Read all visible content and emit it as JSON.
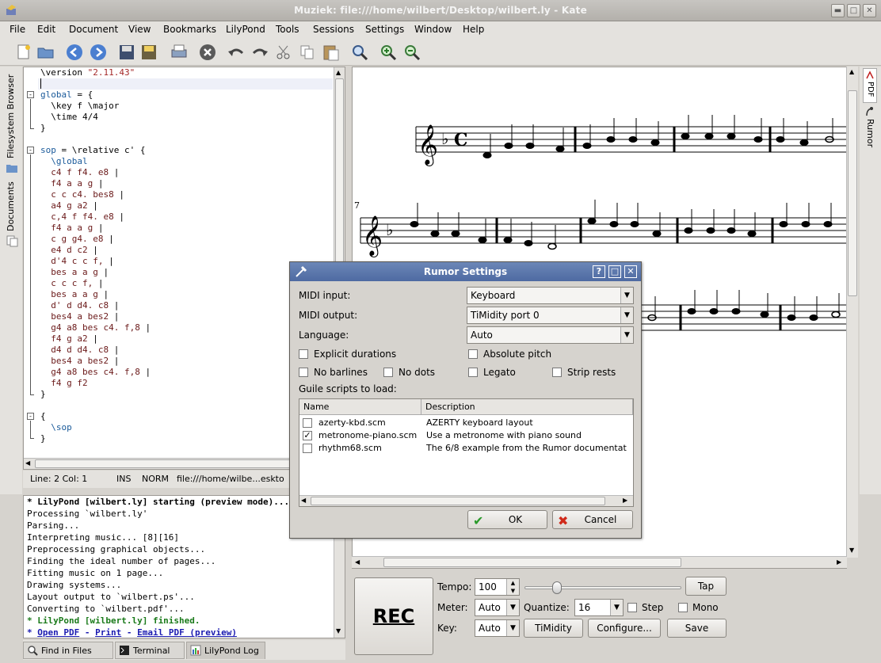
{
  "window": {
    "title": "Muziek: file:///home/wilbert/Desktop/wilbert.ly - Kate"
  },
  "menu": [
    "File",
    "Edit",
    "Document",
    "View",
    "Bookmarks",
    "LilyPond",
    "Tools",
    "Sessions",
    "Settings",
    "Window",
    "Help"
  ],
  "side_tabs": {
    "filesystem": "Filesystem Browser",
    "documents": "Documents"
  },
  "right_tabs": {
    "pdf": "PDF",
    "rumor": "Rumor"
  },
  "status": {
    "position": "Line: 2 Col: 1",
    "mode": "INS",
    "norm": "NORM",
    "path": "file:///home/wilbe...eskto"
  },
  "log": {
    "l1": "* LilyPond [wilbert.ly] starting (preview mode)...",
    "l2": "Processing `wilbert.ly'",
    "l3": "Parsing...",
    "l4": "Interpreting music... [8][16]",
    "l5": "Preprocessing graphical objects...",
    "l6": "Finding the ideal number of pages...",
    "l7": "Fitting music on 1 page...",
    "l8": "Drawing systems...",
    "l9": "Layout output to `wilbert.ps'...",
    "l10": "Converting to `wilbert.pdf'...",
    "l11": "* LilyPond [wilbert.ly] finished.",
    "link_prefix": "* ",
    "open_pdf": "Open PDF",
    "sep": " - ",
    "print": "Print",
    "email_pdf": "Email PDF (preview)"
  },
  "bottom_tabs": {
    "find": "Find in Files",
    "terminal": "Terminal",
    "log": "LilyPond Log"
  },
  "score": {
    "measure_number": "7"
  },
  "rumor": {
    "rec": "REC",
    "tempo_label": "Tempo:",
    "tempo_value": "100",
    "tap": "Tap",
    "meter_label": "Meter:",
    "meter_value": "Auto",
    "quantize_label": "Quantize:",
    "quantize_value": "16",
    "step": "Step",
    "mono": "Mono",
    "key_label": "Key:",
    "key_value": "Auto",
    "timidity": "TiMidity",
    "configure": "Configure...",
    "save": "Save"
  },
  "dialog": {
    "title": "Rumor Settings",
    "midi_input_label": "MIDI input:",
    "midi_input": "Keyboard",
    "midi_output_label": "MIDI output:",
    "midi_output": "TiMidity port 0",
    "language_label": "Language:",
    "language": "Auto",
    "explicit_durations": "Explicit durations",
    "absolute_pitch": "Absolute pitch",
    "no_barlines": "No barlines",
    "no_dots": "No dots",
    "legato": "Legato",
    "strip_rests": "Strip rests",
    "guile_label": "Guile scripts to load:",
    "col_name": "Name",
    "col_desc": "Description",
    "scripts": [
      {
        "name": "azerty-kbd.scm",
        "desc": "AZERTY keyboard layout",
        "checked": false
      },
      {
        "name": "metronome-piano.scm",
        "desc": "Use a metronome with piano sound",
        "checked": true
      },
      {
        "name": "rhythm68.scm",
        "desc": "The 6/8 example from the Rumor documentat",
        "checked": false
      }
    ],
    "ok": "OK",
    "cancel": "Cancel"
  }
}
